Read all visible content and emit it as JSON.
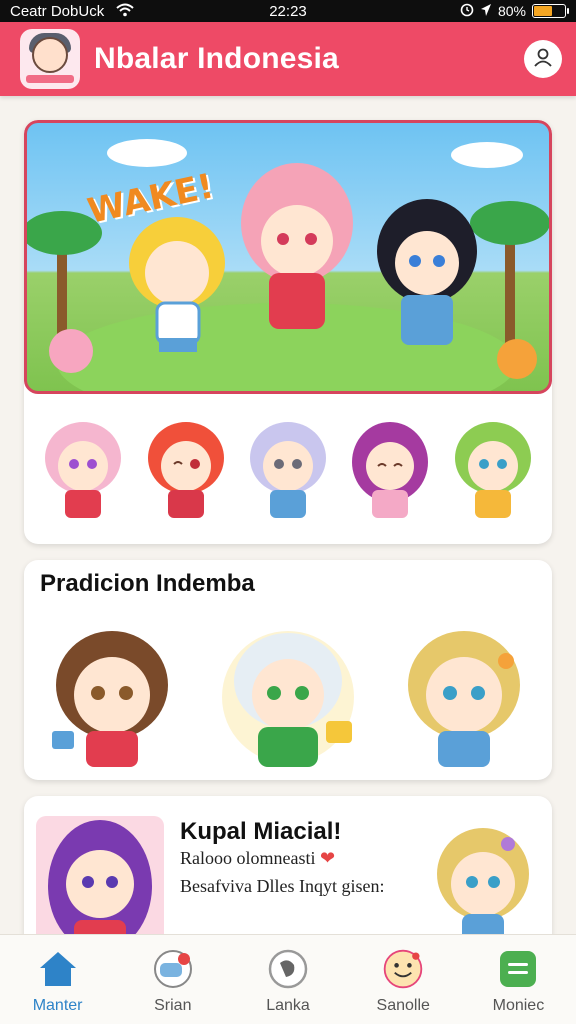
{
  "status_bar": {
    "carrier": "Ceatr DobUck",
    "time": "22:23",
    "battery": "80%",
    "battery_level": 0.55
  },
  "header": {
    "title": "Nbalar Indonesia",
    "profile_icon": "user-icon"
  },
  "hero": {
    "stamp": "WAKE!"
  },
  "section": {
    "title": "Pradicion Indemba"
  },
  "feature": {
    "title": "Kupal Miacial!",
    "line1": "Ralooo olomneasti",
    "line2": "Besafviva Dlles Inqyt gisen:"
  },
  "bottom_nav": [
    {
      "label": "Manter",
      "icon": "home-icon",
      "active": true
    },
    {
      "label": "Srian",
      "icon": "game-controller-icon",
      "active": false
    },
    {
      "label": "Lanka",
      "icon": "globe-icon",
      "active": false
    },
    {
      "label": "Sanolle",
      "icon": "smile-face-icon",
      "active": false
    },
    {
      "label": "Moniec",
      "icon": "menu-icon",
      "active": false
    }
  ],
  "colors": {
    "accent": "#ee4a66",
    "active_nav": "#2e83c8",
    "nav_green": "#4caf50"
  }
}
